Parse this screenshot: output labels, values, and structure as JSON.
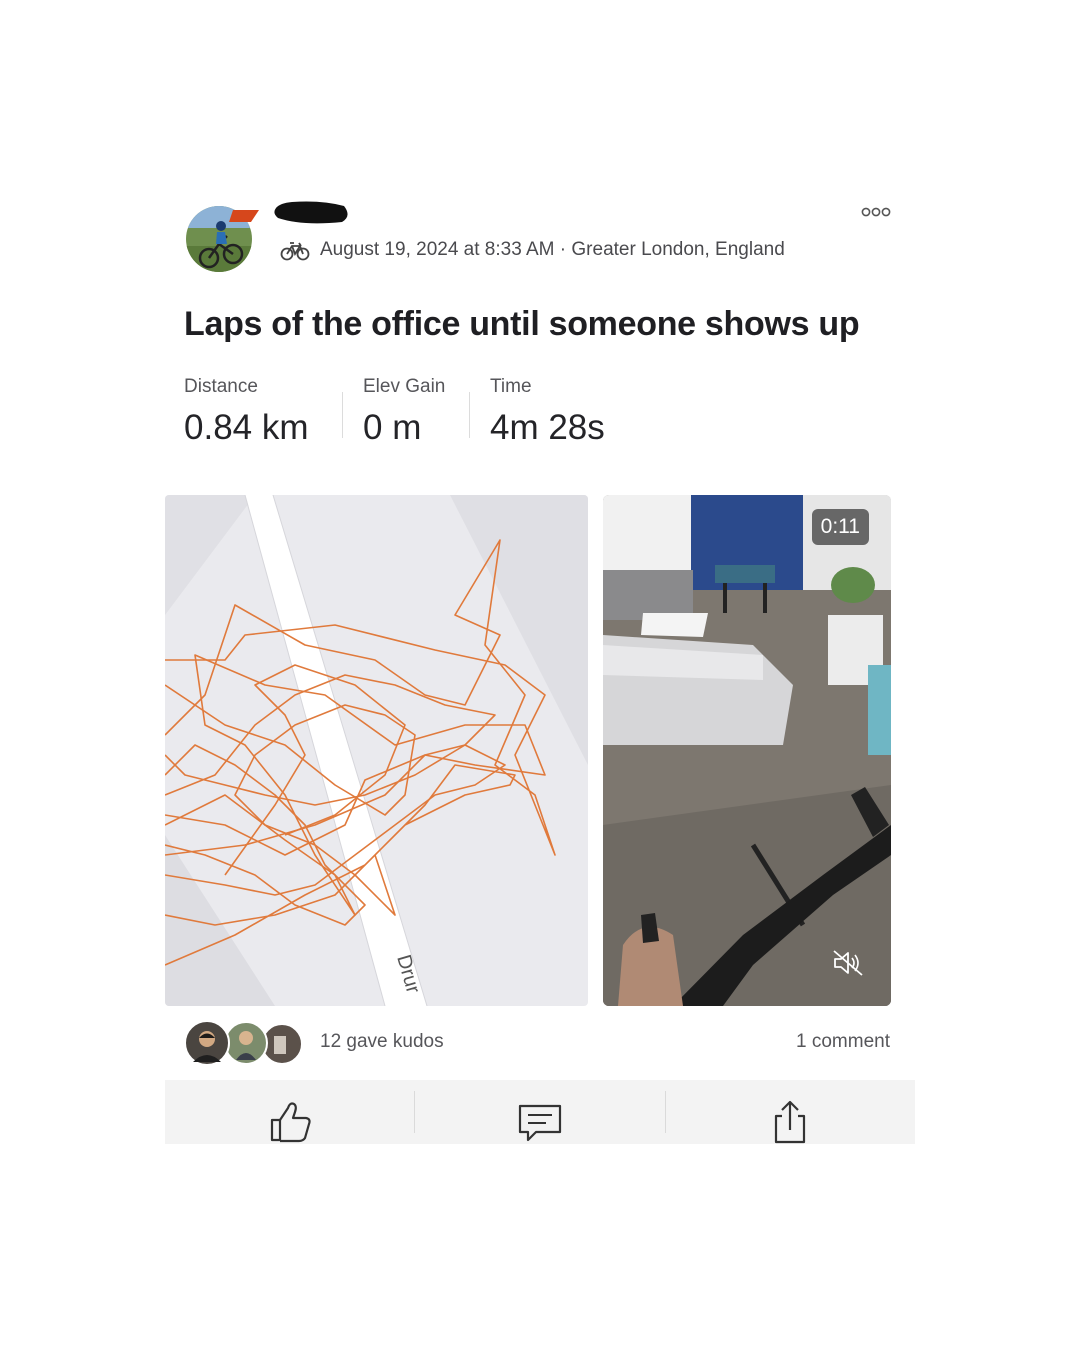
{
  "post": {
    "timestamp": "August 19, 2024 at 8:33 AM",
    "location_sep": " · ",
    "location": "Greater London, England",
    "activity_icon": "bike-icon",
    "title": "Laps of the office until someone shows up"
  },
  "stats": [
    {
      "label": "Distance",
      "value": "0.84 km"
    },
    {
      "label": "Elev Gain",
      "value": "0 m"
    },
    {
      "label": "Time",
      "value": "4m 28s"
    }
  ],
  "map": {
    "street_label": "Drur",
    "route_color": "#e07a3c"
  },
  "video": {
    "duration": "0:11",
    "muted_icon": "speaker-muted-icon"
  },
  "social": {
    "kudos_text": "12 gave kudos",
    "comments_text": "1 comment"
  },
  "actions": [
    {
      "icon": "thumbs-up-icon"
    },
    {
      "icon": "comment-icon"
    },
    {
      "icon": "share-icon"
    }
  ],
  "colors": {
    "accent": "#fc4c02",
    "text": "#242428",
    "muted": "#56565a"
  }
}
